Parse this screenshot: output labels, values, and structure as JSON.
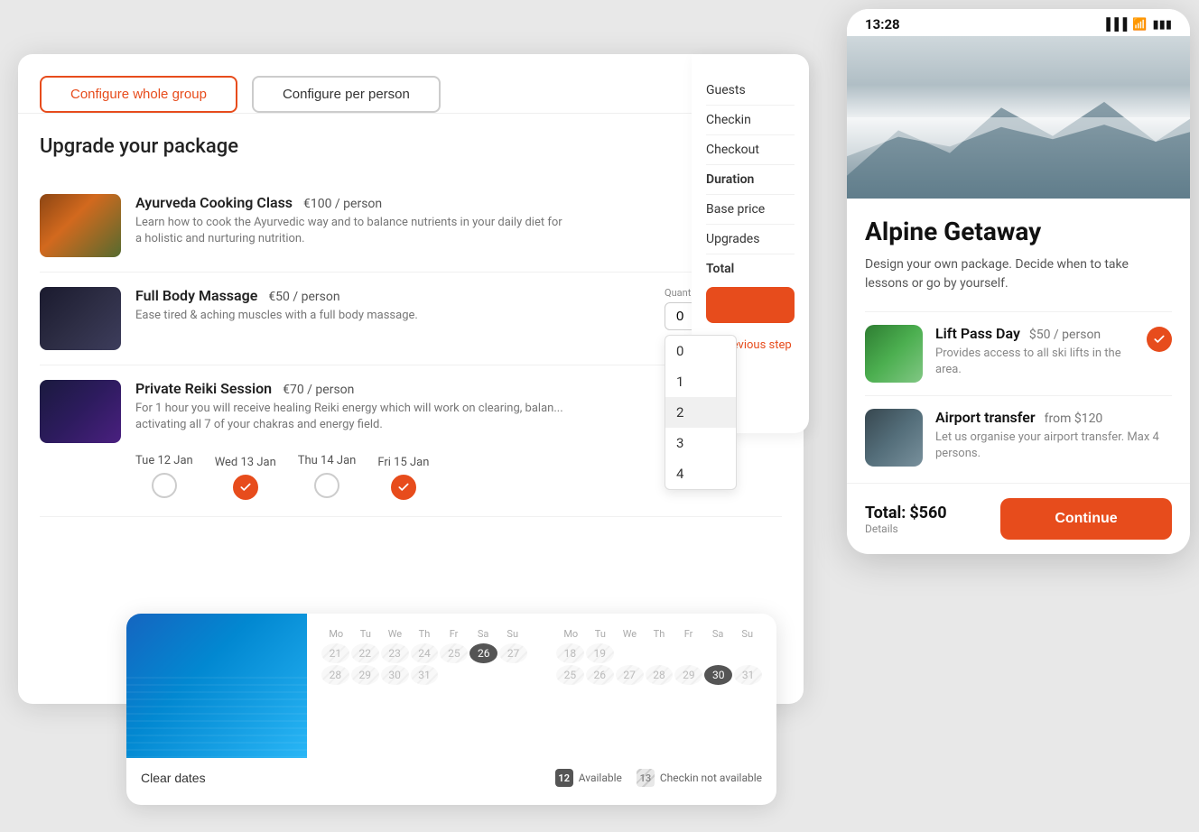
{
  "tabs": {
    "configure_whole_group": "Configure whole group",
    "configure_per_person": "Configure per person"
  },
  "main": {
    "title": "Upgrade your package",
    "packages": [
      {
        "name": "Ayurveda Cooking Class",
        "price": "€100 / person",
        "description": "Learn how to cook the Ayurvedic way and to balance nutrients in your daily diet for a holistic and nurturing nutrition.",
        "selected": true,
        "img_type": "cooking"
      },
      {
        "name": "Full Body Massage",
        "price": "€50 / person",
        "description": "Ease tired & aching muscles with a full body massage.",
        "selected": false,
        "img_type": "massage",
        "quantity_label": "Quantity",
        "quantity_value": "0",
        "quantity_options": [
          "0",
          "1",
          "2",
          "3",
          "4"
        ],
        "dropdown_open": true
      },
      {
        "name": "Private Reiki Session",
        "price": "€70 / person",
        "description": "For 1 hour you will receive healing Reiki energy which will work on clearing, balan... activating all 7 of your chakras and energy field.",
        "selected": false,
        "img_type": "reiki",
        "dates": [
          {
            "label": "Tue 12 Jan",
            "checked": false
          },
          {
            "label": "Wed 13 Jan",
            "checked": true
          },
          {
            "label": "Thu 14 Jan",
            "checked": false
          },
          {
            "label": "Fri 15 Jan",
            "checked": true
          }
        ]
      }
    ]
  },
  "summary": {
    "items": [
      "Guests",
      "Checkin",
      "Checkout",
      "Duration",
      "Base price",
      "Upgrades"
    ],
    "total_label": "Total",
    "prev_step": "Previous step"
  },
  "calendar": {
    "clear_dates": "Clear dates",
    "legend": {
      "available_num": "12",
      "available_label": "Available",
      "checkin_num": "13",
      "checkin_label": "Checkin not available"
    },
    "months": [
      {
        "title": "",
        "days_header": [
          "Mo",
          "Tu",
          "We",
          "Th",
          "Fr",
          "Sa",
          "Su"
        ],
        "days": [
          {
            "n": "21",
            "type": "striped"
          },
          {
            "n": "22",
            "type": "striped"
          },
          {
            "n": "23",
            "type": "striped"
          },
          {
            "n": "24",
            "type": "striped"
          },
          {
            "n": "25",
            "type": "striped"
          },
          {
            "n": "26",
            "type": "selected"
          },
          {
            "n": "27",
            "type": "striped"
          },
          {
            "n": "28",
            "type": "striped"
          },
          {
            "n": "29",
            "type": "striped"
          },
          {
            "n": "30",
            "type": "striped"
          },
          {
            "n": "31",
            "type": "striped"
          }
        ]
      },
      {
        "title": "",
        "days_header": [
          "Mo",
          "Tu",
          "We",
          "Th",
          "Fr",
          "Sa",
          "Su"
        ],
        "days": [
          {
            "n": "18",
            "type": "striped"
          },
          {
            "n": "19",
            "type": "striped"
          },
          {
            "n": "",
            "type": "empty"
          },
          {
            "n": "",
            "type": "empty"
          },
          {
            "n": "",
            "type": "empty"
          },
          {
            "n": "",
            "type": "empty"
          },
          {
            "n": "",
            "type": "empty"
          },
          {
            "n": "25",
            "type": "striped"
          },
          {
            "n": "26",
            "type": "striped"
          },
          {
            "n": "27",
            "type": "striped"
          },
          {
            "n": "28",
            "type": "striped"
          },
          {
            "n": "29",
            "type": "striped"
          },
          {
            "n": "30",
            "type": "selected"
          },
          {
            "n": "31",
            "type": "striped"
          }
        ]
      }
    ]
  },
  "mobile": {
    "status_bar": {
      "time": "13:28"
    },
    "hero_alt": "Alpine mountain ski scene",
    "title": "Alpine Getaway",
    "description": "Design your own package. Decide when to take lessons or go by yourself.",
    "packages": [
      {
        "name": "Lift Pass Day",
        "price": "$50 / person",
        "description": "Provides access to all ski lifts in the area.",
        "selected": true,
        "img_type": "lift"
      },
      {
        "name": "Airport transfer",
        "price_prefix": "from ",
        "price": "$120",
        "description": "Let us organise your airport transfer. Max 4 persons.",
        "selected": false,
        "img_type": "airport"
      }
    ],
    "footer": {
      "total_label": "Total:",
      "total_amount": "$560",
      "details_label": "Details",
      "continue_btn": "Continue"
    }
  }
}
